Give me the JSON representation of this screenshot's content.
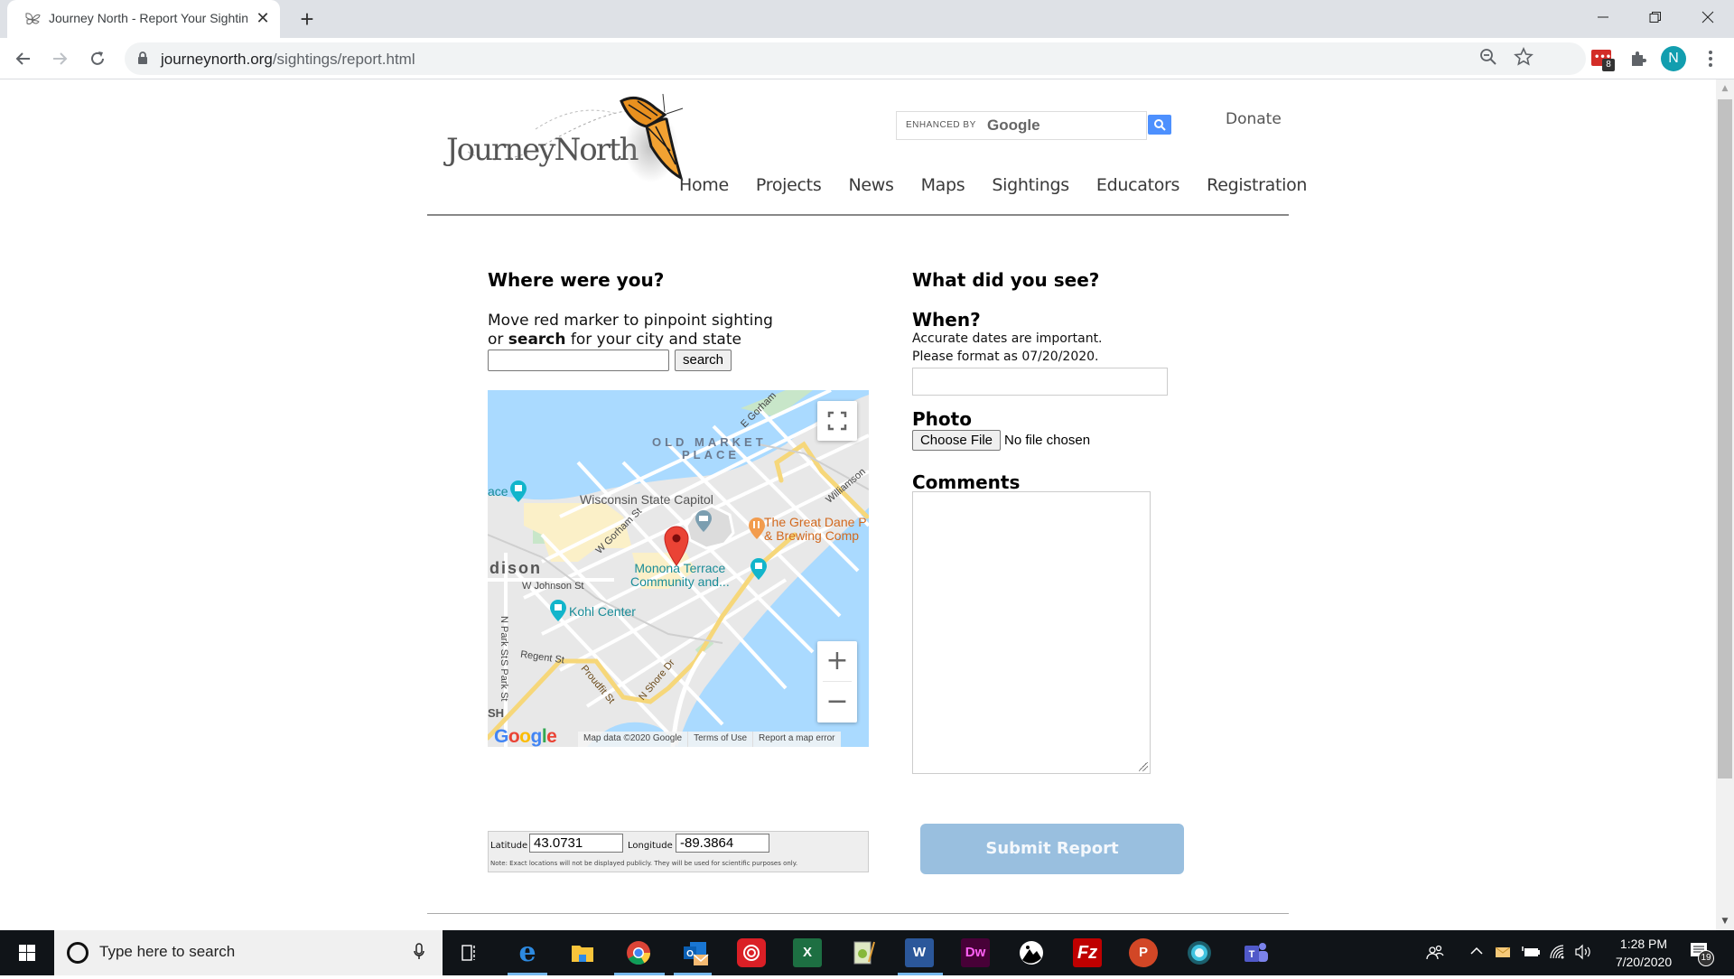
{
  "browser": {
    "tab_title": "Journey North - Report Your Sighting",
    "tab_close": "✕",
    "new_tab": "+",
    "url_domain": "journeynorth.org",
    "url_path": "/sightings/report.html",
    "profile_initial": "N",
    "extension_badge": "8",
    "window_controls": {
      "minimize": "—",
      "maximize": "❐",
      "close": "✕"
    }
  },
  "header": {
    "logo_text": "JourneyNorth",
    "search_enhanced": "ENHANCED BY",
    "search_google": "Google",
    "donate": "Donate",
    "nav": [
      "Home",
      "Projects",
      "News",
      "Maps",
      "Sightings",
      "Educators",
      "Registration"
    ]
  },
  "location": {
    "heading": "Where were you?",
    "instruction_line1": "Move red marker to pinpoint sighting",
    "instruction_or": "or ",
    "instruction_bold": "search",
    "instruction_rest": " for your city and state",
    "search_value": "",
    "search_button": "search",
    "latitude_label": "Latitude",
    "latitude_value": "43.0731",
    "longitude_label": "Longitude",
    "longitude_value": "-89.3864",
    "note": "Note: Exact locations will not be displayed publicly. They will be used for scientific purposes only."
  },
  "map": {
    "labels": {
      "old_market": "OLD MARKET",
      "place": "PLACE",
      "capitol": "Wisconsin State Capitol",
      "great_dane_1": "The Great Dane P",
      "great_dane_2": "& Brewing Comp",
      "monona_1": "Monona Terrace",
      "monona_2": "Community and...",
      "madison": "dison",
      "johnson": "W Johnson St",
      "kohl": "Kohl Center",
      "regent": "Regent St",
      "proudfit": "Proudfit St",
      "nshore": "N Shore Dr",
      "gorham_w": "W Gorham St",
      "gorham_e": "E Gorham",
      "williamson": "Williamson",
      "npark": "N Park St",
      "spark": "S Park St",
      "ace": "ace",
      "sh": "SH"
    },
    "google": "Google",
    "map_data": "Map data ©2020 Google",
    "terms": "Terms of Use",
    "report": "Report a map error",
    "zoom_in": "+",
    "zoom_out": "−"
  },
  "sighting": {
    "heading": "What did you see?",
    "when_heading": "When?",
    "when_note1": "Accurate dates are important.",
    "when_note2": "Please format as 07/20/2020.",
    "date_value": "",
    "photo_heading": "Photo",
    "choose_file": "Choose File",
    "file_status": "No file chosen",
    "comments_heading": "Comments",
    "comments_value": "",
    "submit": "Submit Report"
  },
  "taskbar": {
    "search_placeholder": "Type here to search",
    "time": "1:28 PM",
    "date": "7/20/2020",
    "notification_count": "19",
    "apps": [
      "Task View",
      "Edge",
      "File Explorer",
      "Chrome",
      "Outlook",
      "Creative Cloud",
      "Excel",
      "Notepad++",
      "Word",
      "Dreamweaver",
      "Inkscape",
      "FileZilla",
      "PowerPoint",
      "Camera",
      "Teams"
    ]
  },
  "colors": {
    "submit_bg": "#99bfdf",
    "map_water": "#aadaff",
    "marker": "#ea4335",
    "poi_teal": "#1aa4b8",
    "poi_orange": "#e8833a"
  }
}
